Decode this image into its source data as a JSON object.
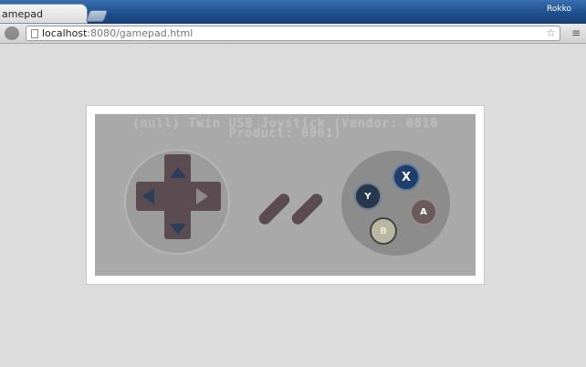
{
  "browser": {
    "tab_title": "amepad",
    "user_name": "Rokko",
    "url_host": "localhost",
    "url_rest": ":8080/gamepad.html"
  },
  "gamepad": {
    "title_line1": "(null) Twin USB Joystick (Vendor: 0810",
    "title_line2": "Product: 0001)",
    "buttons": {
      "y": "Y",
      "x": "X",
      "a": "A",
      "b": "B"
    }
  },
  "colors": {
    "page_bg": "#dcdcdc",
    "pad_bg": "#a9a9a9",
    "dpad": "#5a4c50",
    "button_x": "#1f3e6b",
    "button_y": "#27384e",
    "button_a": "#6c5b5e",
    "button_b": "#b9b6a1"
  }
}
